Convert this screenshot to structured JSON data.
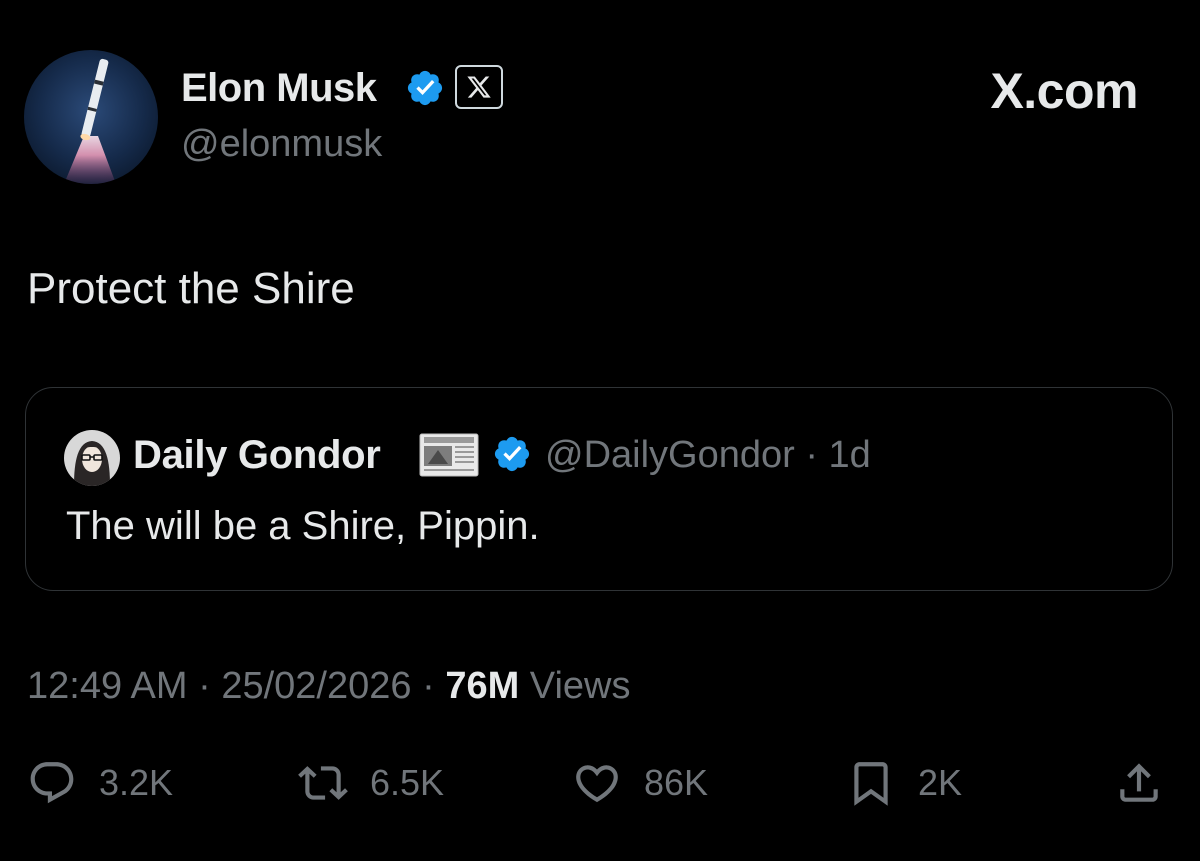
{
  "author": {
    "name": "Elon Musk",
    "handle": "@elonmusk",
    "verified_color": "#1d9bf0",
    "affiliate_badge_icon": "x-logo-icon",
    "avatar_icon": "rocket-launch-avatar"
  },
  "site_label": "X.com",
  "tweet": {
    "text": "Protect the Shire"
  },
  "quote": {
    "name": "Daily Gondor",
    "badge_icon": "newspaper-icon",
    "handle_time": "@DailyGondor · 1d",
    "text": "The will be a Shire, Pippin."
  },
  "meta": {
    "time": "12:49 AM",
    "sep1": " · ",
    "date": "25/02/2026",
    "sep2": " · ",
    "views_count": "76M",
    "views_label": " Views"
  },
  "actions": {
    "replies": {
      "icon": "reply-icon",
      "count": "3.2K"
    },
    "reposts": {
      "icon": "repost-icon",
      "count": "6.5K"
    },
    "likes": {
      "icon": "heart-icon",
      "count": "86K"
    },
    "bookmarks": {
      "icon": "bookmark-icon",
      "count": "2K"
    },
    "share": {
      "icon": "share-icon"
    }
  },
  "colors": {
    "background": "#000000",
    "text_primary": "#e7e9ea",
    "text_secondary": "#71767b",
    "border": "#2f3336",
    "verified": "#1d9bf0"
  }
}
